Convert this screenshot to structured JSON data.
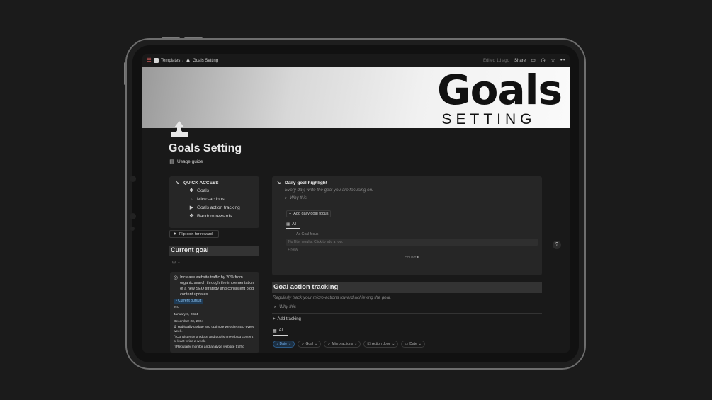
{
  "breadcrumb": {
    "parent": "Templates",
    "current": "Goals Setting"
  },
  "topbar": {
    "edited": "Edited 1d ago",
    "share": "Share"
  },
  "banner": {
    "line1": "Goals",
    "line2": "SETTING"
  },
  "page": {
    "title": "Goals Setting",
    "usage_link": "Usage guide"
  },
  "quick_access": {
    "title": "QUICK ACCESS",
    "items": [
      "Goals",
      "Micro-actions",
      "Goals action tracking",
      "Random rewards"
    ]
  },
  "flip_coin": "Flip coin for reward",
  "current_goal": {
    "title": "Current goal",
    "card": {
      "text": "Increase website traffic by 20% from organic search through the implementation of a new SEO strategy and consistent blog content updates",
      "tag": "Current pursuit",
      "progress": "0%",
      "start": "January 8, 2024",
      "end": "December 23, 2024",
      "actions": [
        "Habitually update and optimize website SEO every week.",
        "Consistently produce and publish new blog content at least twice a week.",
        "Regularly monitor and analyze website traffic"
      ]
    }
  },
  "daily_goal": {
    "title": "Daily goal highlight",
    "subtitle": "Every day, write the goal you are focusing on.",
    "why": "Why this",
    "add_button": "Add daily goal focus",
    "tab": "All",
    "column": "Goal focus",
    "empty": "No filter results. Click to add a row.",
    "new": "New",
    "count_label": "COUNT",
    "count_value": "0"
  },
  "help": "?",
  "goal_action": {
    "title": "Goal action tracking",
    "subtitle": "Regularly track your micro-actions toward achieving the goal.",
    "why": "Why this",
    "add_button": "Add tracking",
    "tab": "All",
    "filters": [
      "Date",
      "Goal",
      "Micro-actions",
      "Action done",
      "Date"
    ]
  },
  "colors": {
    "accent_blue": "#6fb0ef",
    "tag_bg": "#1f3b55",
    "panel": "#262626",
    "background": "#191919"
  }
}
